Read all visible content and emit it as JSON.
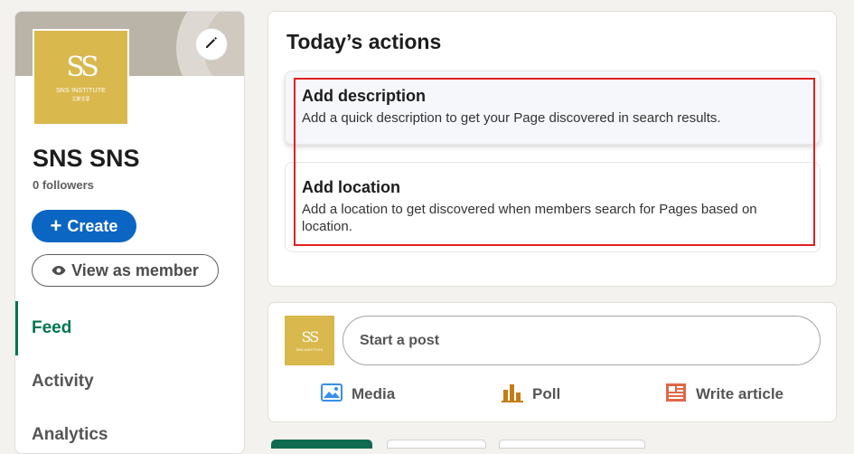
{
  "left": {
    "page_name": "SNS SNS",
    "followers": "0 followers",
    "logo_text": "SNS INSTITUTE",
    "logo_subtext": "艾斯艾思",
    "create_label": "Create",
    "view_label": "View as member",
    "nav": [
      {
        "label": "Feed",
        "active": true
      },
      {
        "label": "Activity",
        "active": false
      },
      {
        "label": "Analytics",
        "active": false
      }
    ],
    "icons": {
      "edit": "pencil-icon",
      "plus": "plus-icon",
      "eye": "eye-icon"
    }
  },
  "actions": {
    "title": "Today’s actions",
    "items": [
      {
        "title": "Add description",
        "desc": "Add a quick description to get your Page discovered in search results."
      },
      {
        "title": "Add location",
        "desc": "Add a location to get discovered when members search for Pages based on location."
      }
    ]
  },
  "post": {
    "placeholder": "Start a post",
    "options": [
      {
        "label": "Media",
        "icon": "image-icon",
        "color": "#378fe9"
      },
      {
        "label": "Poll",
        "icon": "poll-icon",
        "color": "#c37d16"
      },
      {
        "label": "Write article",
        "icon": "article-icon",
        "color": "#e06847"
      }
    ]
  },
  "colors": {
    "brand_blue": "#0a66c2",
    "active_green": "#01754f",
    "logo_gold": "#d9b84d",
    "highlight_red": "#e02020"
  }
}
